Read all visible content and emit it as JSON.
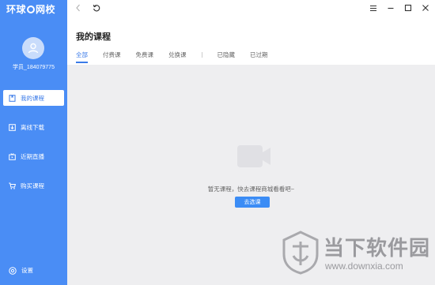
{
  "app": {
    "logo_text_left": "环球",
    "logo_text_right": "网校"
  },
  "user": {
    "name": "学员_184079775"
  },
  "sidebar": {
    "items": [
      {
        "label": "我的课程",
        "icon": "book-icon",
        "active": true
      },
      {
        "label": "离线下载",
        "icon": "download-icon",
        "active": false
      },
      {
        "label": "近期直播",
        "icon": "live-tv-icon",
        "active": false
      },
      {
        "label": "购买课程",
        "icon": "cart-icon",
        "active": false
      }
    ],
    "settings_label": "设置"
  },
  "page": {
    "title": "我的课程"
  },
  "tabs": [
    {
      "label": "全部",
      "active": true
    },
    {
      "label": "付费课",
      "active": false
    },
    {
      "label": "免费课",
      "active": false
    },
    {
      "label": "兑换课",
      "active": false
    },
    {
      "label": "已隐藏",
      "active": false
    },
    {
      "label": "已过期",
      "active": false
    }
  ],
  "empty_state": {
    "message": "暂无课程，快去课程商城看看吧~",
    "button_label": "去选课"
  },
  "watermark": {
    "name": "当下软件园",
    "url": "www.downxia.com"
  },
  "colors": {
    "sidebar_bg": "#4a8df5",
    "accent": "#3b7be8",
    "main_bg": "#eeeef0"
  }
}
